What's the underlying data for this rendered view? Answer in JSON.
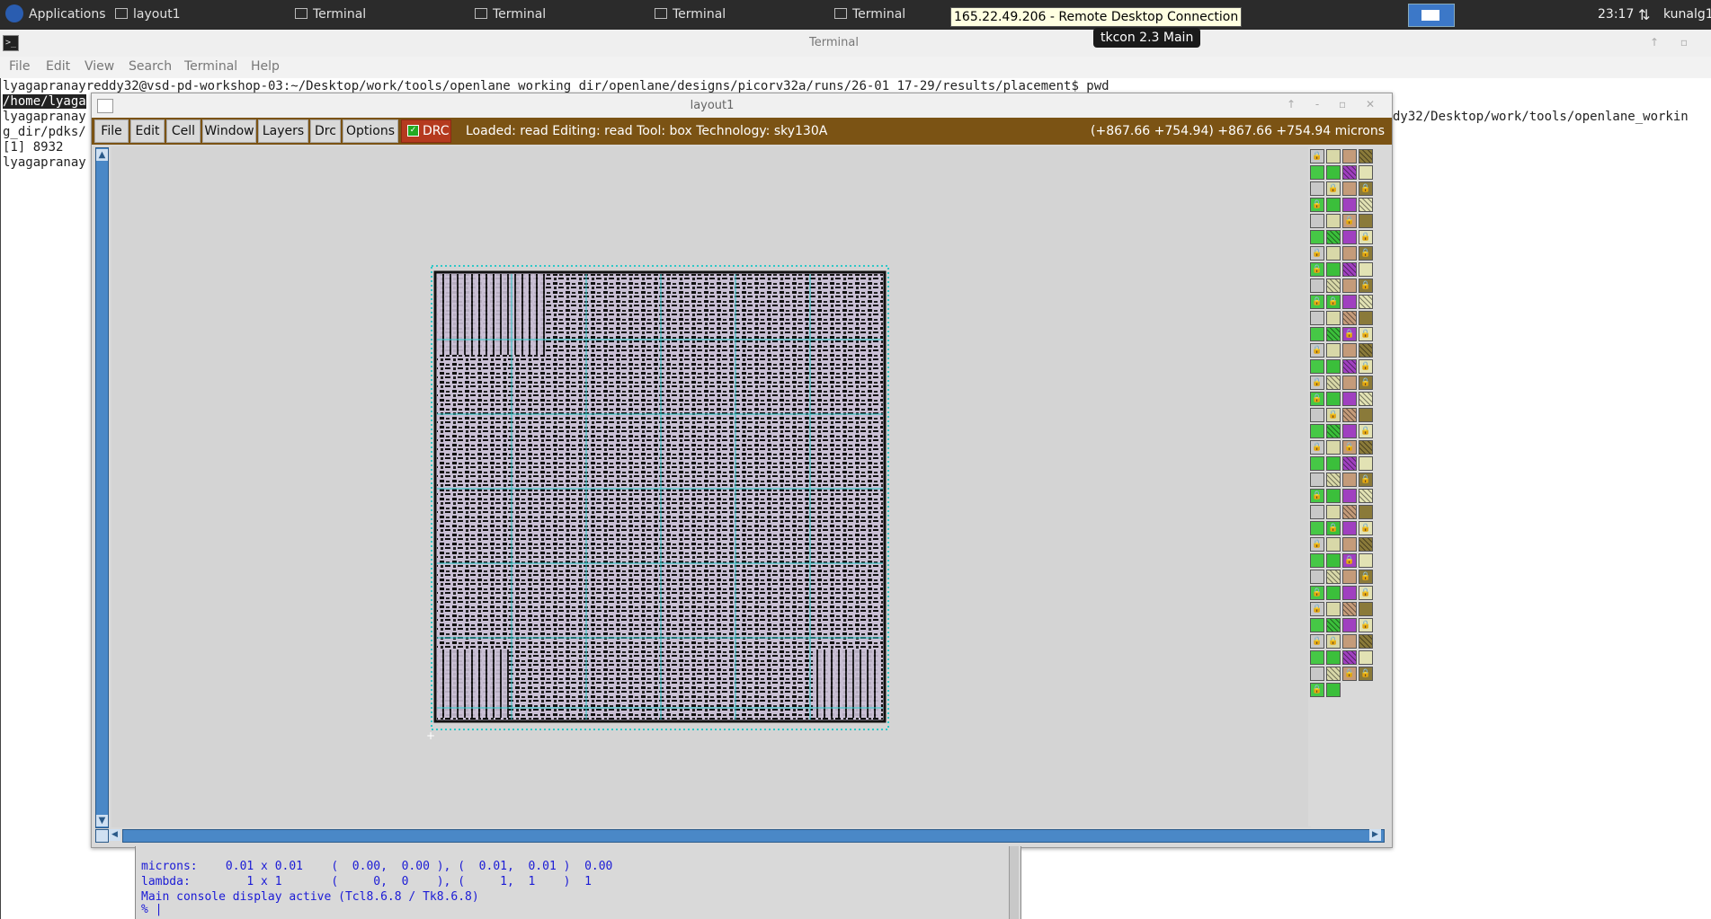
{
  "taskbar": {
    "applications_label": "Applications",
    "items": [
      {
        "label": "layout1"
      },
      {
        "label": "Terminal"
      },
      {
        "label": "Terminal"
      },
      {
        "label": "Terminal"
      },
      {
        "label": "Terminal"
      }
    ],
    "rdc_tooltip": "165.22.49.206 - Remote Desktop Connection",
    "tkcon_tooltip": "tkcon 2.3 Main",
    "clock": "23:17",
    "user": "kunalg1"
  },
  "terminal": {
    "title": "Terminal",
    "menu": [
      "File",
      "Edit",
      "View",
      "Search",
      "Terminal",
      "Help"
    ],
    "lines": {
      "l1": "lyagapranayreddy32@vsd-pd-workshop-03:~/Desktop/work/tools/openlane_working_dir/openlane/designs/picorv32a/runs/26-01_17-29/results/placement$ pwd",
      "l2_hl": "/home/lyaga",
      "l3": "lyagapranay",
      "l3_right": "dy32/Desktop/work/tools/openlane_workin",
      "l4": "g_dir/pdks/",
      "l5": "[1] 8932",
      "l6": "lyagapranay"
    }
  },
  "magic": {
    "title": "layout1",
    "menu": [
      "File",
      "Edit",
      "Cell",
      "Window",
      "Layers",
      "Drc",
      "Options"
    ],
    "drc_label": "DRC",
    "status": "Loaded: read Editing: read Tool: box  Technology: sky130A",
    "coords": "(+867.66 +754.94) +867.66 +754.94 microns",
    "layer_palette": {
      "colors": [
        "#c8c8c8",
        "#e2e2b4",
        "#ffffff",
        "#d8d8a8",
        "#bbbbbb",
        "#a0a0a0",
        "#c49b7a",
        "#d45858",
        "#46c846",
        "#8a7a3a",
        "#c2a070",
        "#3bbf3b",
        "#6f98cf",
        "#d7a6d7",
        "#a040c0",
        "#222222"
      ]
    }
  },
  "tkcon": {
    "line1": "microns:    0.01 x 0.01    (  0.00,  0.00 ), (  0.01,  0.01 )  0.00",
    "line2": "lambda:        1 x 1       (     0,  0    ), (     1,  1    )  1",
    "line3": "Main console display active (Tcl8.6.8 / Tk8.6.8)",
    "prompt": "% |"
  }
}
